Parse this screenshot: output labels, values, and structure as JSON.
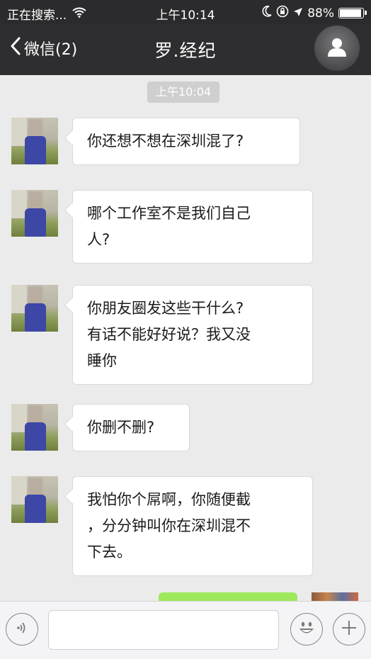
{
  "status_bar": {
    "carrier": "正在搜索...",
    "time": "上午10:14",
    "battery_text": "88%",
    "battery_level": 0.88
  },
  "nav": {
    "back_label": "微信(2)",
    "title": "罗.经纪",
    "profile_icon": "person-icon"
  },
  "chat": {
    "timestamp": "上午10:04",
    "messages": [
      {
        "sender": "other",
        "text": "你还想不想在深圳混了?"
      },
      {
        "sender": "other",
        "text": "哪个工作室不是我们自己\n人?"
      },
      {
        "sender": "other",
        "text": "你朋友圈发这些干什么?\n有话不能好好说？我又没\n睡你"
      },
      {
        "sender": "other",
        "text": "你删不删?"
      },
      {
        "sender": "other",
        "text": "我怕你个屌啊，你随便截\n，分分钟叫你在深圳混不\n下去。"
      }
    ]
  },
  "input_bar": {
    "voice_icon": "voice-icon",
    "placeholder": "",
    "emoji_icon": "emoji-icon",
    "more_icon": "plus-icon"
  },
  "colors": {
    "nav_bg": "#2e2e30",
    "chat_bg": "#ebebeb",
    "self_bubble": "#9ee85c"
  }
}
